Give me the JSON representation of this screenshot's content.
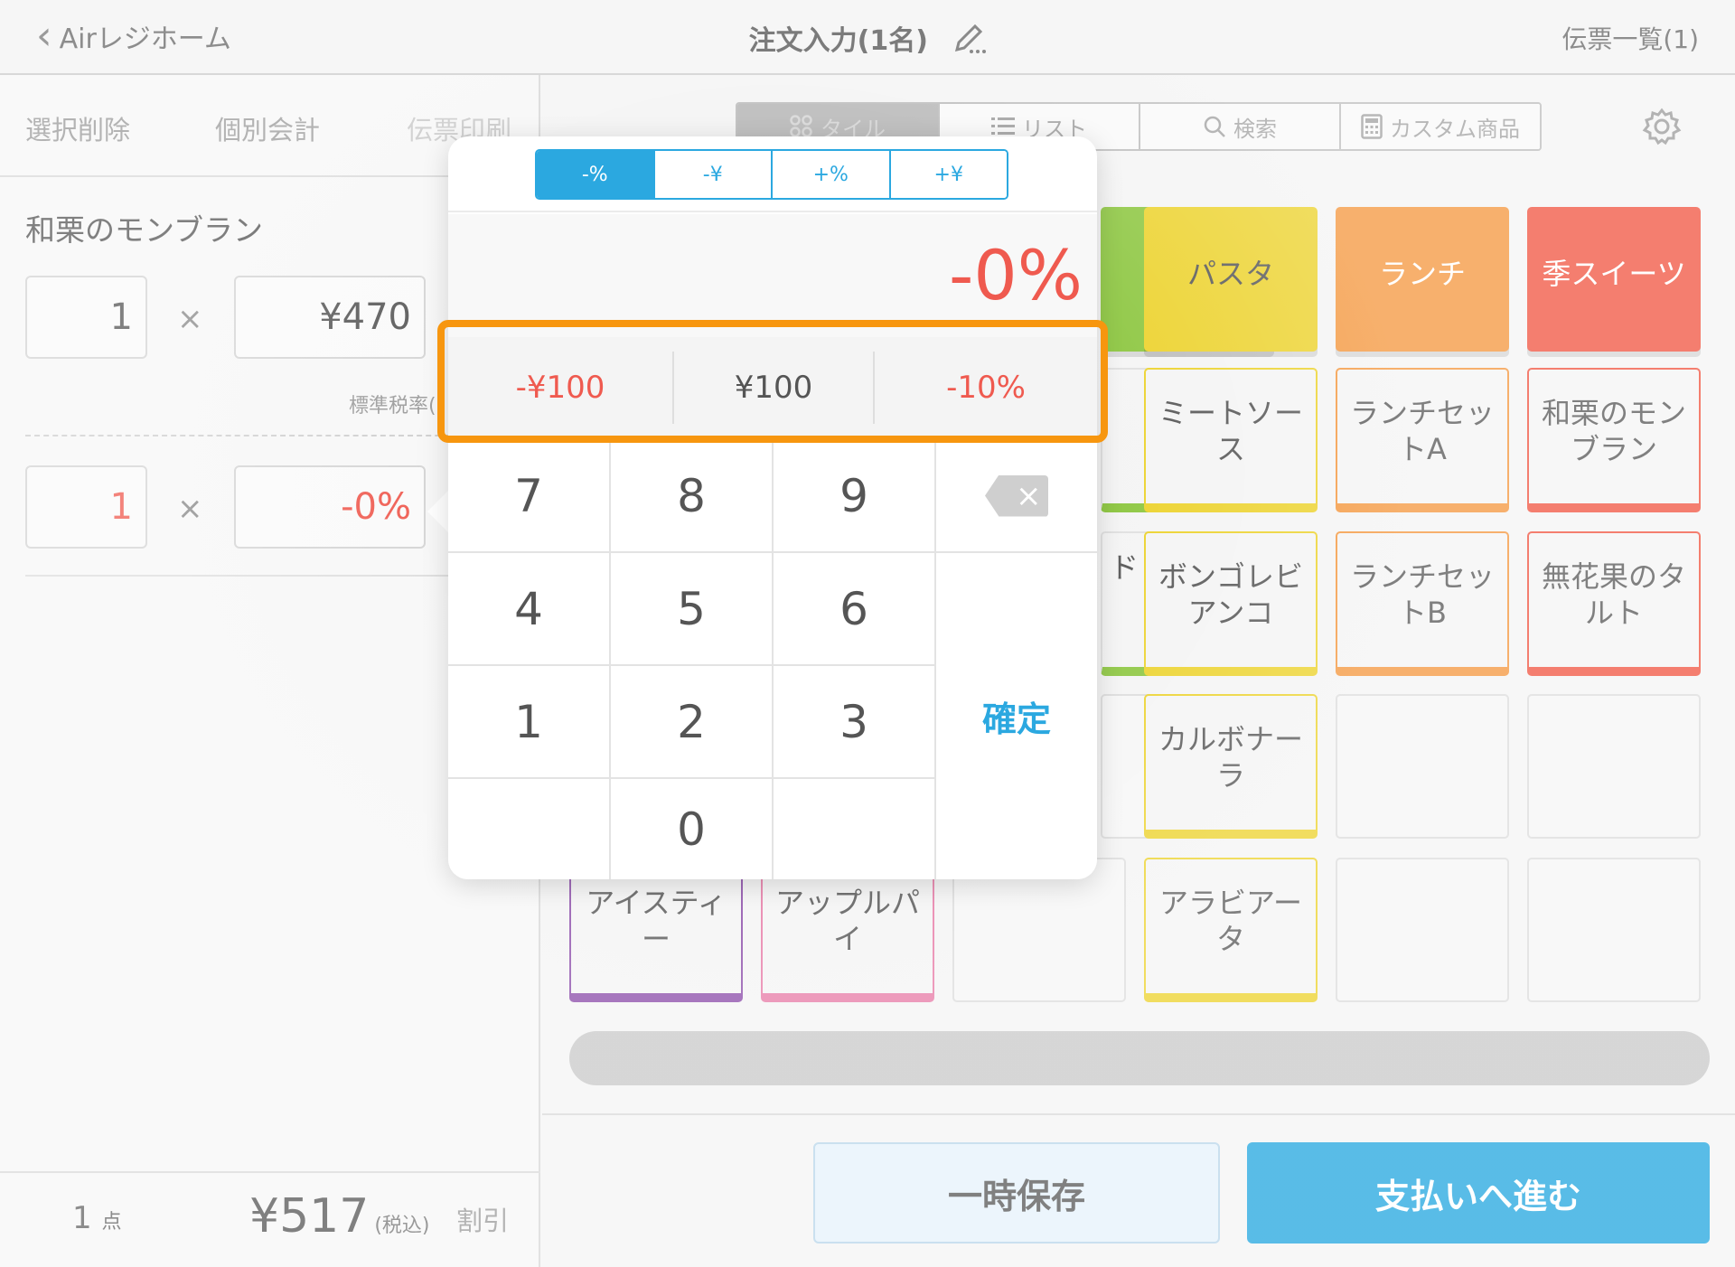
{
  "header": {
    "back_label": "Airレジホーム",
    "title": "注文入力(1名)",
    "slip_list": "伝票一覧(1)"
  },
  "left_toolbar": {
    "delete_selected": "選択削除",
    "individual_payment": "個別会計",
    "print_slip": "伝票印刷"
  },
  "order_item": {
    "name": "和栗のモンブラン",
    "qty": "1",
    "times": "×",
    "price": "¥470",
    "tax_note": "標準税率(",
    "discount_qty": "1",
    "discount_value": "-0%"
  },
  "summary": {
    "count": "1",
    "count_unit": "点",
    "total": "¥517",
    "tax_label": "(税込)",
    "discount_label": "割引"
  },
  "view_tabs": [
    {
      "label": "タイル"
    },
    {
      "label": "リスト"
    },
    {
      "label": "検索"
    },
    {
      "label": "カスタム商品"
    }
  ],
  "tiles": {
    "cat_pasta": "パスタ",
    "cat_lunch": "ランチ",
    "cat_sweets": "季スイーツ",
    "meat_sauce": "ミートソース",
    "lunch_set_a": "ランチセットA",
    "marron": "和栗のモンブラン",
    "vongole": "ボンゴレビアンコ",
    "lunch_set_b": "ランチセットB",
    "fig_tart": "無花果のタルト",
    "carbonara": "カルボナーラ",
    "arrabbiata": "アラビアータ",
    "iced_tea": "アイスティー",
    "apple_pie": "アップルパイ",
    "partial_char": "ド"
  },
  "buttons": {
    "save": "一時保存",
    "pay": "支払いへ進む"
  },
  "keypad": {
    "modes": [
      "-%",
      "-¥",
      "+%",
      "+¥"
    ],
    "display": "-0%",
    "presets": [
      "-¥100",
      "¥100",
      "-10%"
    ],
    "keys": [
      "7",
      "8",
      "9",
      "4",
      "5",
      "6",
      "1",
      "2",
      "3",
      "0"
    ],
    "enter": "確定",
    "backspace": "×"
  },
  "colors": {
    "accent": "#2ba8e0",
    "discount_red": "#ef5a4f",
    "highlight": "#f7960f",
    "pasta": "#ecd22b",
    "lunch": "#f4963c",
    "sweets": "#f0533f",
    "green": "#8cc63f",
    "purple": "#8a4aa8",
    "pink": "#e77aa6"
  }
}
